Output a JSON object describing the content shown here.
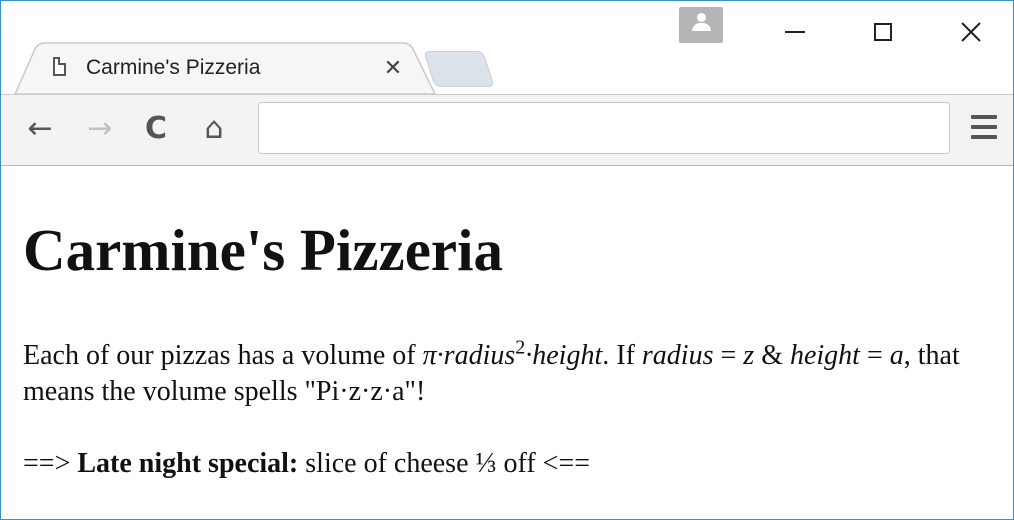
{
  "browser": {
    "tab_title": "Carmine's Pizzeria",
    "tab_close_glyph": "✕",
    "address_value": "",
    "icons": {
      "back": "back-arrow-icon",
      "forward": "forward-arrow-icon",
      "reload": "reload-icon",
      "home": "home-icon",
      "menu": "hamburger-menu-icon",
      "profile": "profile-icon"
    },
    "glyphs": {
      "back": "←",
      "forward": "→",
      "reload": "C",
      "home": "⌂",
      "close": "✕"
    }
  },
  "page": {
    "heading": "Carmine's Pizzeria",
    "para": {
      "t1": "Each of our pizzas has a volume of ",
      "pi": "π",
      "dot1": "·",
      "radius": "radius",
      "exp": "2",
      "dot2": "·",
      "height": "height",
      "t2": ". If ",
      "radius2": "radius",
      "t3": " = ",
      "z": "z",
      "t4": " & ",
      "height2": "height",
      "t5": " = ",
      "a": "a",
      "t6": ", that means the volume spells \"Pi·z·z·a\"!"
    },
    "special": {
      "prefix": "==> ",
      "label": "Late night special:",
      "text": " slice of cheese ⅓ off  <=="
    }
  },
  "colors": {
    "window_border": "#3b8fc7",
    "toolbar_bg": "#f3f3f3",
    "new_tab": "#dbe2ea",
    "profile_btn": "#b5b5b5"
  }
}
